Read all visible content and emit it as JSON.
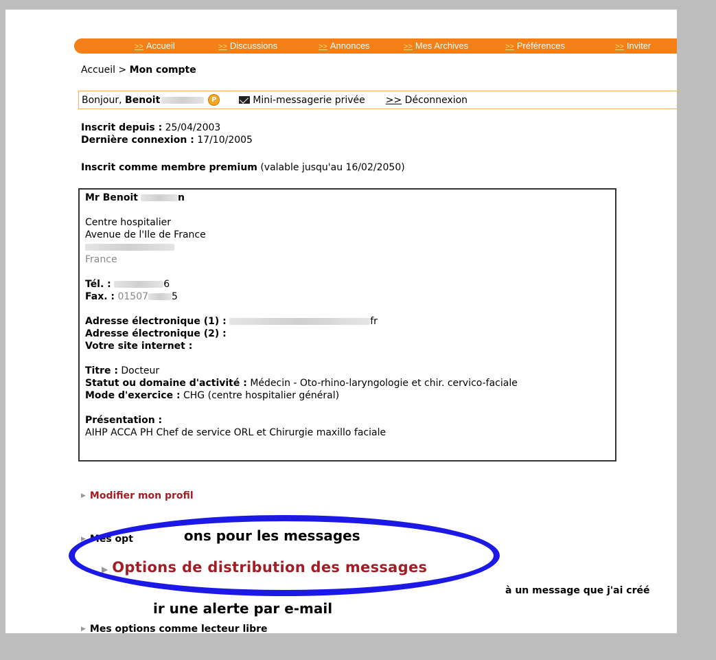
{
  "nav": {
    "arrow": ">>",
    "items": [
      "Accueil",
      "Discussions",
      "Annonces",
      "Mes Archives",
      "Préférences",
      "Inviter"
    ]
  },
  "breadcrumb": {
    "home": "Accueil",
    "separator": ">",
    "current": "Mon compte"
  },
  "greeting": {
    "prefix": "Bonjour, ",
    "name": "Benoit",
    "coin_letter": "P",
    "messaging_label": "Mini-messagerie privée",
    "logout_arrow": ">>",
    "logout_label": "Déconnexion"
  },
  "account": {
    "registered_label": "Inscrit depuis :",
    "registered_value": "25/04/2003",
    "last_login_label": "Dernière connexion :",
    "last_login_value": "17/10/2005",
    "premium_label": "Inscrit comme membre premium",
    "premium_validity": "(valable jusqu'au 16/02/2050)"
  },
  "profile": {
    "name_first": "Mr Benoit",
    "name_last": "n",
    "address_line1": "Centre hospitalier",
    "address_line2": "Avenue de l'Ile de France",
    "country": "France",
    "tel_label": "Tél. :",
    "tel_value": "6",
    "fax_label": "Fax. :",
    "fax_value": "01507",
    "fax_end": "5",
    "email1_label": "Adresse électronique (1) :",
    "email1_value": "fr",
    "email2_label": "Adresse électronique (2) :",
    "website_label": "Votre site internet :",
    "title_label": "Titre :",
    "title_value": "Docteur",
    "status_label": "Statut ou domaine d'activité :",
    "status_value": "Médecin - Oto-rhino-laryngologie et chir. cervico-faciale",
    "mode_label": "Mode d'exercice :",
    "mode_value": "CHG (centre hospitalier général)",
    "presentation_label": "Présentation :",
    "presentation_value": "AIHP ACCA PH Chef de service ORL et Chirurgie maxillo faciale"
  },
  "links": {
    "edit_profile": "Modifier mon profil",
    "message_options_a": "Mes opt",
    "message_options_b": "ons pour les messages",
    "distribution": "Options de distribution des messages",
    "alert_a": "ir une alerte par e-mail",
    "alert_b": "à un message que j'ai créé",
    "reader_options": "Mes options comme lecteur libre"
  }
}
